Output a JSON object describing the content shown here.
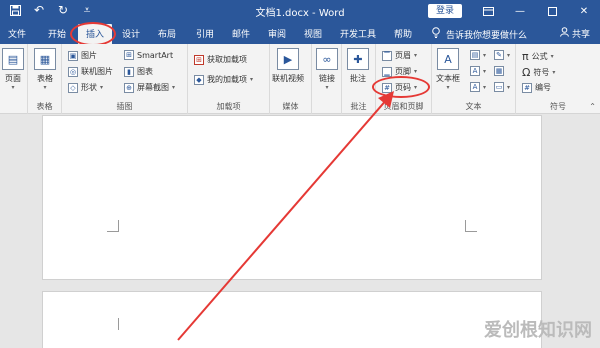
{
  "window": {
    "title": "文档1.docx  -  Word",
    "login": "登录"
  },
  "tabs": [
    "文件",
    "开始",
    "插入",
    "设计",
    "布局",
    "引用",
    "邮件",
    "审阅",
    "视图",
    "开发工具",
    "帮助"
  ],
  "tell_me": "告诉我你想要做什么",
  "share": "共享",
  "ribbon": {
    "pages": {
      "label": "页面"
    },
    "tables": {
      "label": "表格",
      "btn": "表格"
    },
    "illustrations": {
      "label": "插图",
      "pictures": "图片",
      "online_pictures": "联机图片",
      "shapes": "形状",
      "smartart": "SmartArt",
      "chart": "图表",
      "screenshot": "屏幕截图"
    },
    "addins": {
      "label": "加载项",
      "get": "获取加载项",
      "my": "我的加载项"
    },
    "media": {
      "label": "媒体",
      "online_video": "联机视频"
    },
    "links": {
      "btn": "链接"
    },
    "comments": {
      "label": "批注",
      "btn": "批注"
    },
    "header_footer": {
      "label": "页眉和页脚",
      "header": "页眉",
      "footer": "页脚",
      "page_number": "页码"
    },
    "text": {
      "label": "文本",
      "textbox": "文本框"
    },
    "symbols": {
      "label": "符号",
      "equation": "公式",
      "symbol": "符号",
      "number": "编号"
    }
  },
  "watermark": "爱创根知识网",
  "colors": {
    "brand": "#2b579a",
    "annotation": "#e53935"
  },
  "icons": [
    "save-icon",
    "undo-icon",
    "redo-icon",
    "customize-icon",
    "ribbon-display-icon",
    "minimize-icon",
    "maximize-icon",
    "close-icon",
    "lightbulb-icon",
    "person-icon"
  ]
}
